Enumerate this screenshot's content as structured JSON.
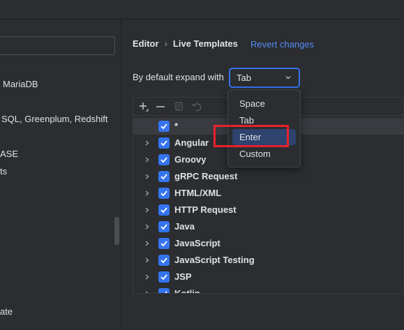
{
  "sidebar": {
    "search_value": "",
    "items": [
      {
        "label": "MariaDB"
      },
      {
        "label": "SQL, Greenplum, Redshift"
      },
      {
        "label": "ASE"
      },
      {
        "label": "ts"
      },
      {
        "label": "ate"
      }
    ]
  },
  "header": {
    "breadcrumb": [
      "Editor",
      "Live Templates"
    ],
    "revert_label": "Revert changes"
  },
  "expand": {
    "label": "By default expand with",
    "value": "Tab",
    "options": [
      "Space",
      "Tab",
      "Enter",
      "Custom"
    ],
    "highlighted_option": "Enter"
  },
  "toolbar": {
    "icons": [
      "add-icon",
      "remove-icon",
      "copy-icon",
      "undo-icon"
    ]
  },
  "tree": {
    "rows": [
      {
        "label": "*",
        "checked": true,
        "expandable": false
      },
      {
        "label": "Angular",
        "checked": true,
        "expandable": true
      },
      {
        "label": "Groovy",
        "checked": true,
        "expandable": true
      },
      {
        "label": "gRPC Request",
        "checked": true,
        "expandable": true
      },
      {
        "label": "HTML/XML",
        "checked": true,
        "expandable": true
      },
      {
        "label": "HTTP Request",
        "checked": true,
        "expandable": true
      },
      {
        "label": "Java",
        "checked": true,
        "expandable": true
      },
      {
        "label": "JavaScript",
        "checked": true,
        "expandable": true
      },
      {
        "label": "JavaScript Testing",
        "checked": true,
        "expandable": true
      },
      {
        "label": "JSP",
        "checked": true,
        "expandable": true
      },
      {
        "label": "Kotlin",
        "checked": true,
        "expandable": true
      }
    ]
  },
  "colors": {
    "accent": "#3574f0",
    "link": "#548af7",
    "highlight_border": "#e8212b",
    "background": "#2b2d30"
  }
}
